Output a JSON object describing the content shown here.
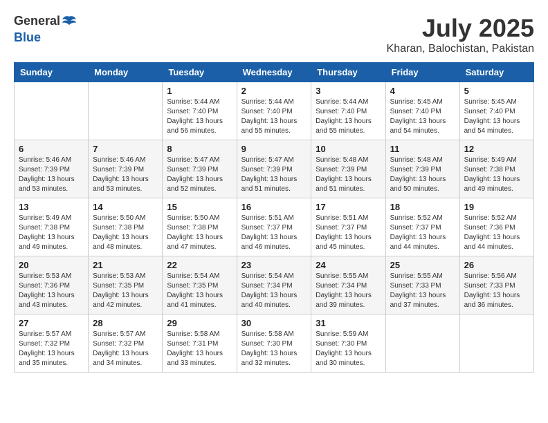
{
  "header": {
    "logo_general": "General",
    "logo_blue": "Blue",
    "month": "July 2025",
    "location": "Kharan, Balochistan, Pakistan"
  },
  "weekdays": [
    "Sunday",
    "Monday",
    "Tuesday",
    "Wednesday",
    "Thursday",
    "Friday",
    "Saturday"
  ],
  "weeks": [
    [
      {
        "day": "",
        "info": ""
      },
      {
        "day": "",
        "info": ""
      },
      {
        "day": "1",
        "info": "Sunrise: 5:44 AM\nSunset: 7:40 PM\nDaylight: 13 hours\nand 56 minutes."
      },
      {
        "day": "2",
        "info": "Sunrise: 5:44 AM\nSunset: 7:40 PM\nDaylight: 13 hours\nand 55 minutes."
      },
      {
        "day": "3",
        "info": "Sunrise: 5:44 AM\nSunset: 7:40 PM\nDaylight: 13 hours\nand 55 minutes."
      },
      {
        "day": "4",
        "info": "Sunrise: 5:45 AM\nSunset: 7:40 PM\nDaylight: 13 hours\nand 54 minutes."
      },
      {
        "day": "5",
        "info": "Sunrise: 5:45 AM\nSunset: 7:40 PM\nDaylight: 13 hours\nand 54 minutes."
      }
    ],
    [
      {
        "day": "6",
        "info": "Sunrise: 5:46 AM\nSunset: 7:39 PM\nDaylight: 13 hours\nand 53 minutes."
      },
      {
        "day": "7",
        "info": "Sunrise: 5:46 AM\nSunset: 7:39 PM\nDaylight: 13 hours\nand 53 minutes."
      },
      {
        "day": "8",
        "info": "Sunrise: 5:47 AM\nSunset: 7:39 PM\nDaylight: 13 hours\nand 52 minutes."
      },
      {
        "day": "9",
        "info": "Sunrise: 5:47 AM\nSunset: 7:39 PM\nDaylight: 13 hours\nand 51 minutes."
      },
      {
        "day": "10",
        "info": "Sunrise: 5:48 AM\nSunset: 7:39 PM\nDaylight: 13 hours\nand 51 minutes."
      },
      {
        "day": "11",
        "info": "Sunrise: 5:48 AM\nSunset: 7:39 PM\nDaylight: 13 hours\nand 50 minutes."
      },
      {
        "day": "12",
        "info": "Sunrise: 5:49 AM\nSunset: 7:38 PM\nDaylight: 13 hours\nand 49 minutes."
      }
    ],
    [
      {
        "day": "13",
        "info": "Sunrise: 5:49 AM\nSunset: 7:38 PM\nDaylight: 13 hours\nand 49 minutes."
      },
      {
        "day": "14",
        "info": "Sunrise: 5:50 AM\nSunset: 7:38 PM\nDaylight: 13 hours\nand 48 minutes."
      },
      {
        "day": "15",
        "info": "Sunrise: 5:50 AM\nSunset: 7:38 PM\nDaylight: 13 hours\nand 47 minutes."
      },
      {
        "day": "16",
        "info": "Sunrise: 5:51 AM\nSunset: 7:37 PM\nDaylight: 13 hours\nand 46 minutes."
      },
      {
        "day": "17",
        "info": "Sunrise: 5:51 AM\nSunset: 7:37 PM\nDaylight: 13 hours\nand 45 minutes."
      },
      {
        "day": "18",
        "info": "Sunrise: 5:52 AM\nSunset: 7:37 PM\nDaylight: 13 hours\nand 44 minutes."
      },
      {
        "day": "19",
        "info": "Sunrise: 5:52 AM\nSunset: 7:36 PM\nDaylight: 13 hours\nand 44 minutes."
      }
    ],
    [
      {
        "day": "20",
        "info": "Sunrise: 5:53 AM\nSunset: 7:36 PM\nDaylight: 13 hours\nand 43 minutes."
      },
      {
        "day": "21",
        "info": "Sunrise: 5:53 AM\nSunset: 7:35 PM\nDaylight: 13 hours\nand 42 minutes."
      },
      {
        "day": "22",
        "info": "Sunrise: 5:54 AM\nSunset: 7:35 PM\nDaylight: 13 hours\nand 41 minutes."
      },
      {
        "day": "23",
        "info": "Sunrise: 5:54 AM\nSunset: 7:34 PM\nDaylight: 13 hours\nand 40 minutes."
      },
      {
        "day": "24",
        "info": "Sunrise: 5:55 AM\nSunset: 7:34 PM\nDaylight: 13 hours\nand 39 minutes."
      },
      {
        "day": "25",
        "info": "Sunrise: 5:55 AM\nSunset: 7:33 PM\nDaylight: 13 hours\nand 37 minutes."
      },
      {
        "day": "26",
        "info": "Sunrise: 5:56 AM\nSunset: 7:33 PM\nDaylight: 13 hours\nand 36 minutes."
      }
    ],
    [
      {
        "day": "27",
        "info": "Sunrise: 5:57 AM\nSunset: 7:32 PM\nDaylight: 13 hours\nand 35 minutes."
      },
      {
        "day": "28",
        "info": "Sunrise: 5:57 AM\nSunset: 7:32 PM\nDaylight: 13 hours\nand 34 minutes."
      },
      {
        "day": "29",
        "info": "Sunrise: 5:58 AM\nSunset: 7:31 PM\nDaylight: 13 hours\nand 33 minutes."
      },
      {
        "day": "30",
        "info": "Sunrise: 5:58 AM\nSunset: 7:30 PM\nDaylight: 13 hours\nand 32 minutes."
      },
      {
        "day": "31",
        "info": "Sunrise: 5:59 AM\nSunset: 7:30 PM\nDaylight: 13 hours\nand 30 minutes."
      },
      {
        "day": "",
        "info": ""
      },
      {
        "day": "",
        "info": ""
      }
    ]
  ]
}
